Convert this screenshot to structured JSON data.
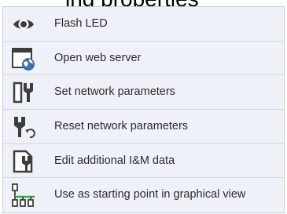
{
  "menu": {
    "items": [
      {
        "label": "Flash LED",
        "icon": "eye-icon"
      },
      {
        "label": "Open web server",
        "icon": "web-browser-globe-icon"
      },
      {
        "label": "Set network parameters",
        "icon": "network-parameters-icon"
      },
      {
        "label": "Reset network parameters",
        "icon": "reset-network-icon"
      },
      {
        "label": "Edit additional I&M data",
        "icon": "edit-document-icon"
      },
      {
        "label": "Use as starting point in graphical view",
        "icon": "network-topology-icon"
      }
    ]
  },
  "colors": {
    "menu_background": "#eef2f8",
    "icon_dark": "#3d3d3d",
    "globe_blue": "#3f6ea8",
    "topology_green": "#3aa83a"
  }
}
